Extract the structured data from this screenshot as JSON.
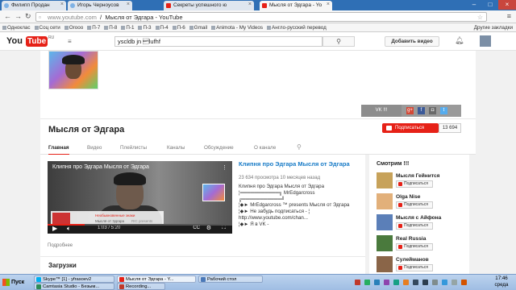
{
  "browser": {
    "tabs": [
      {
        "label": "Филипп Продан",
        "active": false
      },
      {
        "label": "Игорь Черноусов",
        "active": false
      },
      {
        "label": "Секреты успешного ю",
        "active": false
      },
      {
        "label": "Мысля от Эдгара - Yo",
        "active": true
      }
    ],
    "url_domain": "www.youtube.com",
    "url_title": "Мысля от Эдгара - YouTube",
    "bookmarks": [
      "Одноклас",
      "Соц сети",
      "Orooo",
      "П-7",
      "П-8",
      "П-1",
      "П-3",
      "П-4",
      "П-6",
      "Gmail",
      "Animota - My Videos",
      "Англо-русский перевод"
    ],
    "other_bookmarks": "Другие закладки"
  },
  "youtube": {
    "logo_you": "You",
    "logo_tube": "Tube",
    "logo_region": "RU",
    "search_value": "yscldb jn \u0004lufhf",
    "upload_label": "Добавить видео"
  },
  "channel": {
    "title": "Мысля от Эдгара",
    "subscribe_label": "Подписаться",
    "subscriber_count": "13 694",
    "social_vk": "VK !!!",
    "tabs": [
      "Главная",
      "Видео",
      "Плейлисты",
      "Каналы",
      "Обсуждение",
      "О канале"
    ],
    "active_tab": "Главная"
  },
  "featured": {
    "player_title": "Клипня про Эдгара Мысля от Эдгара",
    "overlay_line1": "Необыкновенные знаки",
    "overlay_line2": "Мысля от Эдгара",
    "overlay_line3": "RIC presents",
    "time": "1:03 / 5:20",
    "progress_fraction": 0.2,
    "title": "Клипня про Эдгара Мысля от Эдгара",
    "meta": "23 634 просмотра  10 месяцев назад",
    "description": "Клипня про Эдгара Мысля от Эдгара\n¦═══════════╗ MrEdgarcross\n╔═══════════╝\n¦◆► MrEdgarcross ™ presents Мысля от Эдгара\n¦◆► Не забудь подписаться - ¦\nhttp://www.youtube.com/chan...\n¦◆► Я в VK -",
    "more_label": "Подробнее"
  },
  "uploads_label": "Загрузки",
  "sidebar": {
    "heading": "Смотрим !!!",
    "subscribe_label": "Подписаться",
    "channels": [
      {
        "name": "Мысля Гейнится",
        "avatar_color": "#c7a25a"
      },
      {
        "name": "Olga Nise",
        "avatar_color": "#e2b07a"
      },
      {
        "name": "Мысля с Айфона",
        "avatar_color": "#5b7fb8"
      },
      {
        "name": "Real Russia",
        "avatar_color": "#4a7a3d"
      },
      {
        "name": "Сулейманов",
        "avatar_color": "#8a6548"
      }
    ]
  },
  "taskbar": {
    "start_label": "Пуск",
    "tasks": [
      {
        "label": "Skype™ [1] - yfrasoev2",
        "color": "#00aff0",
        "active": false
      },
      {
        "label": "Мысля от Эдгара - Y...",
        "color": "#e62117",
        "active": true
      },
      {
        "label": "Рабочий стол",
        "color": "#4b79b8",
        "active": false
      },
      {
        "label": "Camtasia Studio - Безым...",
        "color": "#2e8b57",
        "active": false
      },
      {
        "label": "Recording...",
        "color": "#c0392b",
        "active": false
      }
    ],
    "time": "17:46",
    "day": "среда"
  }
}
